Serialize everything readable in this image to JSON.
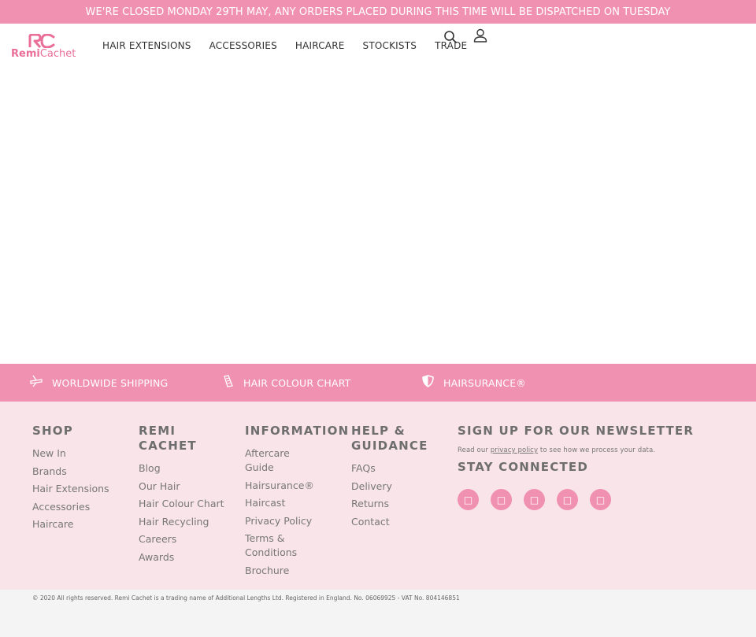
{
  "announcement": "WE'RE CLOSED MONDAY 29TH MAY, ANY ORDERS PLACED DURING THIS TIME WILL BE DISPATCHED ON TUESDAY",
  "brand": {
    "logo_bold": "Remi",
    "logo_light": "Cachet",
    "accent": "#f191b1"
  },
  "nav": {
    "items": [
      "HAIR EXTENSIONS",
      "ACCESSORIES",
      "HAIRCARE",
      "STOCKISTS",
      "TRADE"
    ],
    "icons": [
      "search-icon",
      "account-icon"
    ]
  },
  "features": [
    {
      "icon": "plane-icon",
      "label": "WORLDWIDE SHIPPING"
    },
    {
      "icon": "colour-swatch-icon",
      "label": "HAIR COLOUR CHART"
    },
    {
      "icon": "shield-icon",
      "label": "HAIRSURANCE®"
    }
  ],
  "footer": {
    "shop": {
      "title": "SHOP",
      "links": [
        "New In",
        "Brands",
        "Hair Extensions",
        "Accessories",
        "Haircare"
      ]
    },
    "remi": {
      "title": "REMI CACHET",
      "links": [
        "Blog",
        "Our Hair",
        "Hair Colour Chart",
        "Hair Recycling",
        "Careers",
        "Awards"
      ]
    },
    "information": {
      "title": "INFORMATION",
      "links": [
        "Aftercare Guide",
        "Hairsurance®",
        "Haircast",
        "Privacy Policy",
        "Terms & Conditions",
        "Brochure"
      ]
    },
    "help": {
      "title": "HELP & GUIDANCE",
      "links": [
        "FAQs",
        "Delivery",
        "Returns",
        "Contact"
      ]
    },
    "newsletter": {
      "title": "SIGN UP FOR OUR NEWSLETTER",
      "note_before": "Read our ",
      "note_link": "privacy policy",
      "note_after": " to see how we process your data."
    },
    "connected": {
      "title": "STAY CONNECTED",
      "icons": [
        "facebook-icon",
        "twitter-icon",
        "instagram-icon",
        "pinterest-icon",
        "youtube-icon"
      ]
    }
  },
  "copyright": "© 2020 All rights reserved. Remi Cachet is a trading name of Additional Lengths Ltd. Registered in England. No. 06069925 - VAT No. 804146851"
}
